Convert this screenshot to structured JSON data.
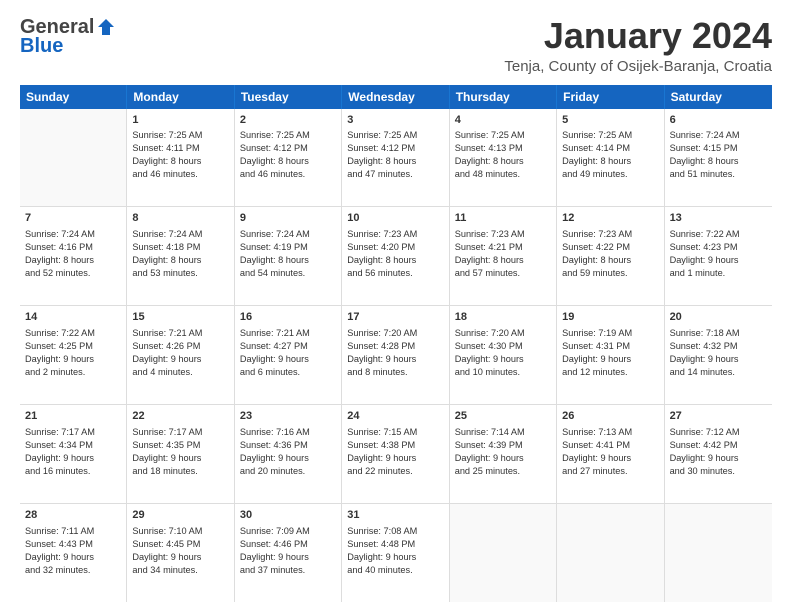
{
  "header": {
    "logo": {
      "line1": "General",
      "line2": "Blue"
    },
    "title": "January 2024",
    "location": "Tenja, County of Osijek-Baranja, Croatia"
  },
  "weekdays": [
    "Sunday",
    "Monday",
    "Tuesday",
    "Wednesday",
    "Thursday",
    "Friday",
    "Saturday"
  ],
  "weeks": [
    [
      {
        "day": "",
        "lines": []
      },
      {
        "day": "1",
        "lines": [
          "Sunrise: 7:25 AM",
          "Sunset: 4:11 PM",
          "Daylight: 8 hours",
          "and 46 minutes."
        ]
      },
      {
        "day": "2",
        "lines": [
          "Sunrise: 7:25 AM",
          "Sunset: 4:12 PM",
          "Daylight: 8 hours",
          "and 46 minutes."
        ]
      },
      {
        "day": "3",
        "lines": [
          "Sunrise: 7:25 AM",
          "Sunset: 4:12 PM",
          "Daylight: 8 hours",
          "and 47 minutes."
        ]
      },
      {
        "day": "4",
        "lines": [
          "Sunrise: 7:25 AM",
          "Sunset: 4:13 PM",
          "Daylight: 8 hours",
          "and 48 minutes."
        ]
      },
      {
        "day": "5",
        "lines": [
          "Sunrise: 7:25 AM",
          "Sunset: 4:14 PM",
          "Daylight: 8 hours",
          "and 49 minutes."
        ]
      },
      {
        "day": "6",
        "lines": [
          "Sunrise: 7:24 AM",
          "Sunset: 4:15 PM",
          "Daylight: 8 hours",
          "and 51 minutes."
        ]
      }
    ],
    [
      {
        "day": "7",
        "lines": [
          "Sunrise: 7:24 AM",
          "Sunset: 4:16 PM",
          "Daylight: 8 hours",
          "and 52 minutes."
        ]
      },
      {
        "day": "8",
        "lines": [
          "Sunrise: 7:24 AM",
          "Sunset: 4:18 PM",
          "Daylight: 8 hours",
          "and 53 minutes."
        ]
      },
      {
        "day": "9",
        "lines": [
          "Sunrise: 7:24 AM",
          "Sunset: 4:19 PM",
          "Daylight: 8 hours",
          "and 54 minutes."
        ]
      },
      {
        "day": "10",
        "lines": [
          "Sunrise: 7:23 AM",
          "Sunset: 4:20 PM",
          "Daylight: 8 hours",
          "and 56 minutes."
        ]
      },
      {
        "day": "11",
        "lines": [
          "Sunrise: 7:23 AM",
          "Sunset: 4:21 PM",
          "Daylight: 8 hours",
          "and 57 minutes."
        ]
      },
      {
        "day": "12",
        "lines": [
          "Sunrise: 7:23 AM",
          "Sunset: 4:22 PM",
          "Daylight: 8 hours",
          "and 59 minutes."
        ]
      },
      {
        "day": "13",
        "lines": [
          "Sunrise: 7:22 AM",
          "Sunset: 4:23 PM",
          "Daylight: 9 hours",
          "and 1 minute."
        ]
      }
    ],
    [
      {
        "day": "14",
        "lines": [
          "Sunrise: 7:22 AM",
          "Sunset: 4:25 PM",
          "Daylight: 9 hours",
          "and 2 minutes."
        ]
      },
      {
        "day": "15",
        "lines": [
          "Sunrise: 7:21 AM",
          "Sunset: 4:26 PM",
          "Daylight: 9 hours",
          "and 4 minutes."
        ]
      },
      {
        "day": "16",
        "lines": [
          "Sunrise: 7:21 AM",
          "Sunset: 4:27 PM",
          "Daylight: 9 hours",
          "and 6 minutes."
        ]
      },
      {
        "day": "17",
        "lines": [
          "Sunrise: 7:20 AM",
          "Sunset: 4:28 PM",
          "Daylight: 9 hours",
          "and 8 minutes."
        ]
      },
      {
        "day": "18",
        "lines": [
          "Sunrise: 7:20 AM",
          "Sunset: 4:30 PM",
          "Daylight: 9 hours",
          "and 10 minutes."
        ]
      },
      {
        "day": "19",
        "lines": [
          "Sunrise: 7:19 AM",
          "Sunset: 4:31 PM",
          "Daylight: 9 hours",
          "and 12 minutes."
        ]
      },
      {
        "day": "20",
        "lines": [
          "Sunrise: 7:18 AM",
          "Sunset: 4:32 PM",
          "Daylight: 9 hours",
          "and 14 minutes."
        ]
      }
    ],
    [
      {
        "day": "21",
        "lines": [
          "Sunrise: 7:17 AM",
          "Sunset: 4:34 PM",
          "Daylight: 9 hours",
          "and 16 minutes."
        ]
      },
      {
        "day": "22",
        "lines": [
          "Sunrise: 7:17 AM",
          "Sunset: 4:35 PM",
          "Daylight: 9 hours",
          "and 18 minutes."
        ]
      },
      {
        "day": "23",
        "lines": [
          "Sunrise: 7:16 AM",
          "Sunset: 4:36 PM",
          "Daylight: 9 hours",
          "and 20 minutes."
        ]
      },
      {
        "day": "24",
        "lines": [
          "Sunrise: 7:15 AM",
          "Sunset: 4:38 PM",
          "Daylight: 9 hours",
          "and 22 minutes."
        ]
      },
      {
        "day": "25",
        "lines": [
          "Sunrise: 7:14 AM",
          "Sunset: 4:39 PM",
          "Daylight: 9 hours",
          "and 25 minutes."
        ]
      },
      {
        "day": "26",
        "lines": [
          "Sunrise: 7:13 AM",
          "Sunset: 4:41 PM",
          "Daylight: 9 hours",
          "and 27 minutes."
        ]
      },
      {
        "day": "27",
        "lines": [
          "Sunrise: 7:12 AM",
          "Sunset: 4:42 PM",
          "Daylight: 9 hours",
          "and 30 minutes."
        ]
      }
    ],
    [
      {
        "day": "28",
        "lines": [
          "Sunrise: 7:11 AM",
          "Sunset: 4:43 PM",
          "Daylight: 9 hours",
          "and 32 minutes."
        ]
      },
      {
        "day": "29",
        "lines": [
          "Sunrise: 7:10 AM",
          "Sunset: 4:45 PM",
          "Daylight: 9 hours",
          "and 34 minutes."
        ]
      },
      {
        "day": "30",
        "lines": [
          "Sunrise: 7:09 AM",
          "Sunset: 4:46 PM",
          "Daylight: 9 hours",
          "and 37 minutes."
        ]
      },
      {
        "day": "31",
        "lines": [
          "Sunrise: 7:08 AM",
          "Sunset: 4:48 PM",
          "Daylight: 9 hours",
          "and 40 minutes."
        ]
      },
      {
        "day": "",
        "lines": []
      },
      {
        "day": "",
        "lines": []
      },
      {
        "day": "",
        "lines": []
      }
    ]
  ]
}
